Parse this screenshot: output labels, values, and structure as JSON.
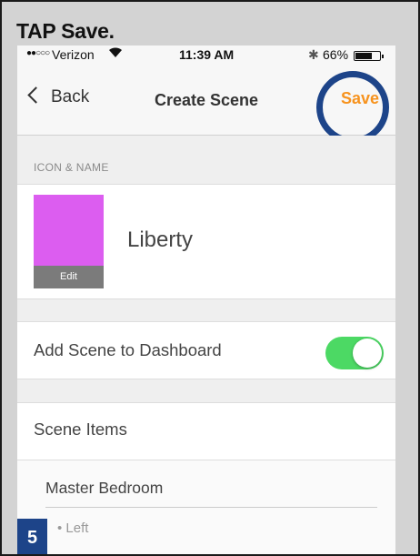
{
  "instruction": {
    "text": "TAP Save."
  },
  "step": {
    "number": "5"
  },
  "status_bar": {
    "signal": "●●○○○",
    "carrier": "Verizon",
    "wifi": "wifi-icon",
    "time": "11:39 AM",
    "bluetooth": "bluetooth-icon",
    "battery": "66%",
    "battery_level": 0.66
  },
  "nav": {
    "back_label": "Back",
    "title": "Create Scene",
    "save_label": "Save",
    "accent_color": "#f7931e",
    "highlight_color": "#1d4489"
  },
  "icon_section": {
    "header": "ICON & NAME",
    "icon_color": "#dc5df0",
    "edit_label": "Edit",
    "scene_name": "Liberty"
  },
  "dashboard": {
    "label": "Add Scene to Dashboard",
    "toggle_on": true,
    "toggle_color": "#4cd964"
  },
  "scene_items": {
    "label": "Scene Items",
    "rooms": [
      {
        "name": "Master Bedroom",
        "items": [
          "• Left"
        ]
      }
    ]
  }
}
